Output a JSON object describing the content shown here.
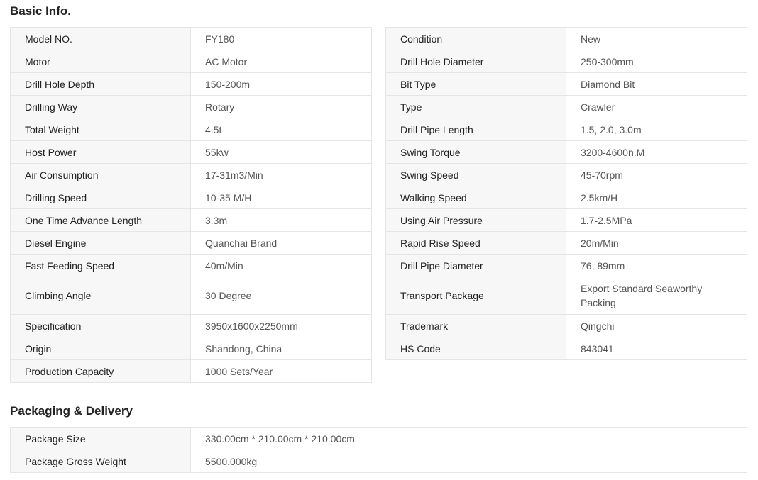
{
  "basic_info": {
    "title": "Basic Info.",
    "left_rows": [
      {
        "label": "Model NO.",
        "value": "FY180"
      },
      {
        "label": "Motor",
        "value": "AC Motor"
      },
      {
        "label": "Drill Hole Depth",
        "value": "150-200m"
      },
      {
        "label": "Drilling Way",
        "value": "Rotary"
      },
      {
        "label": "Total Weight",
        "value": "4.5t"
      },
      {
        "label": "Host Power",
        "value": "55kw"
      },
      {
        "label": "Air Consumption",
        "value": "17-31m3/Min"
      },
      {
        "label": "Drilling Speed",
        "value": "10-35 M/H"
      },
      {
        "label": "One Time Advance Length",
        "value": "3.3m"
      },
      {
        "label": "Diesel Engine",
        "value": "Quanchai Brand"
      },
      {
        "label": "Fast Feeding Speed",
        "value": "40m/Min"
      },
      {
        "label": "Climbing Angle",
        "value": "30 Degree"
      },
      {
        "label": "Specification",
        "value": "3950x1600x2250mm"
      },
      {
        "label": "Origin",
        "value": "Shandong, China"
      },
      {
        "label": "Production Capacity",
        "value": "1000 Sets/Year"
      }
    ],
    "right_rows": [
      {
        "label": "Condition",
        "value": "New"
      },
      {
        "label": "Drill Hole Diameter",
        "value": "250-300mm"
      },
      {
        "label": "Bit Type",
        "value": "Diamond Bit"
      },
      {
        "label": "Type",
        "value": "Crawler"
      },
      {
        "label": "Drill Pipe Length",
        "value": "1.5, 2.0, 3.0m"
      },
      {
        "label": "Swing Torque",
        "value": "3200-4600n.M"
      },
      {
        "label": "Swing Speed",
        "value": "45-70rpm"
      },
      {
        "label": "Walking Speed",
        "value": "2.5km/H"
      },
      {
        "label": "Using Air Pressure",
        "value": "1.7-2.5MPa"
      },
      {
        "label": "Rapid Rise Speed",
        "value": "20m/Min"
      },
      {
        "label": "Drill Pipe Diameter",
        "value": "76, 89mm"
      },
      {
        "label": "Transport Package",
        "value": "Export Standard Seaworthy Packing"
      },
      {
        "label": "Trademark",
        "value": "Qingchi"
      },
      {
        "label": "HS Code",
        "value": "843041"
      }
    ]
  },
  "packaging": {
    "title": "Packaging & Delivery",
    "rows": [
      {
        "label": "Package Size",
        "value": "330.00cm * 210.00cm * 210.00cm"
      },
      {
        "label": "Package Gross Weight",
        "value": "5500.000kg"
      }
    ]
  }
}
